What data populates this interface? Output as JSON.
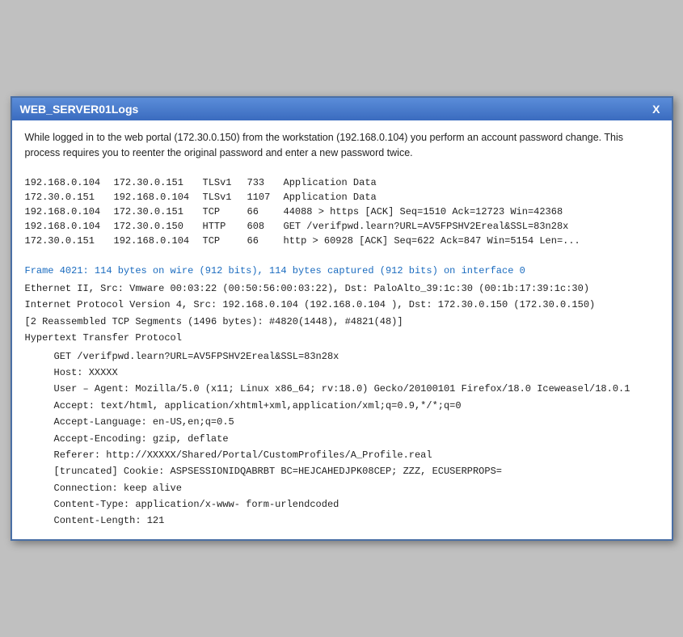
{
  "window": {
    "title": "WEB_SERVER01Logs",
    "close_label": "X"
  },
  "intro": {
    "text": "While logged in to the web portal (172.30.0.150) from the workstation (192.168.0.104) you perform an account password change.  This process requires you to reenter the original password and enter a new password twice."
  },
  "packets": [
    {
      "src": "192.168.0.104",
      "dst": "172.30.0.151",
      "proto": "TLSv1",
      "len": "733",
      "info": "Application Data"
    },
    {
      "src": "172.30.0.151",
      "dst": "192.168.0.104",
      "proto": "TLSv1",
      "len": "1107",
      "info": "Application Data"
    },
    {
      "src": "192.168.0.104",
      "dst": "172.30.0.151",
      "proto": "TCP",
      "len": "66",
      "info": "44088 > https  [ACK]  Seq=1510 Ack=12723  Win=42368"
    },
    {
      "src": "192.168.0.104",
      "dst": "172.30.0.150",
      "proto": "HTTP",
      "len": "608",
      "info": "GET /verifpwd.learn?URL=AV5FPSHV2Ereal&SSL=83n28x"
    },
    {
      "src": "172.30.0.151",
      "dst": "192.168.0.104",
      "proto": "TCP",
      "len": "66",
      "info": "http > 60928  [ACK]  Seq=622  Ack=847  Win=5154  Len=..."
    }
  ],
  "frame": {
    "link_text": "Frame 4021:  114 bytes on wire (912 bits), 114 bytes captured (912 bits) on interface 0",
    "ethernet": "Ethernet II, Src:  Vmware 00:03:22  (00:50:56:00:03:22),  Dst:  PaloAlto_39:1c:30  (00:1b:17:39:1c:30)",
    "ip": "Internet Protocol Version 4, Src:  192.168.0.104 (192.168.0.104 ),  Dst:  172.30.0.150 (172.30.0.150)",
    "tcp_segments": "[2 Reassembled  TCP Segments (1496 bytes): #4820(1448), #4821(48)]",
    "http_label": "Hypertext Transfer Protocol"
  },
  "http": {
    "get": "GET /verifpwd.learn?URL=AV5FPSHV2Ereal&SSL=83n28x",
    "host": "Host:  XXXXX",
    "user_agent": "User – Agent:  Mozilla/5.0 (x11;  Linux x86_64;  rv:18.0)  Gecko/20100101  Firefox/18.0  Iceweasel/18.0.1",
    "accept": "Accept:  text/html, application/xhtml+xml,application/xml;q=0.9,*/*;q=0",
    "accept_lang": "Accept-Language:  en-US,en;q=0.5",
    "accept_enc": "Accept-Encoding:  gzip,  deflate",
    "referer": "Referer:  http://XXXXX/Shared/Portal/CustomProfiles/A_Profile.real",
    "cookie": "[truncated]  Cookie:  ASPSESSIONIDQABRBT BC=HEJCAHEDJPK08CEP;  ZZZ,  ECUSERPROPS=",
    "connection": "Connection:  keep alive",
    "content_type": "Content-Type:  application/x-www- form-urlendcoded",
    "content_length": "Content-Length:  121"
  }
}
